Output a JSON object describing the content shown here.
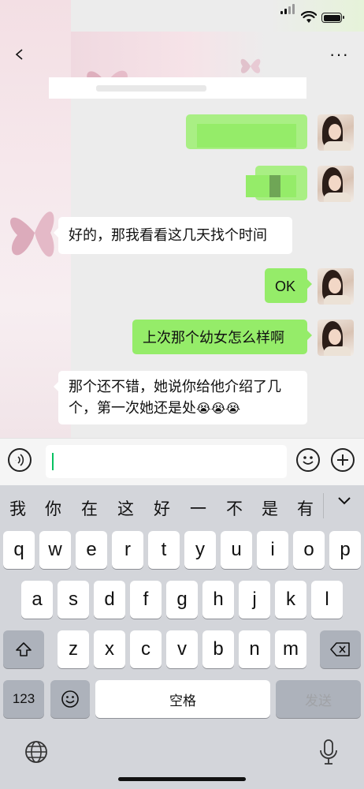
{
  "status_bar": {
    "signal": "signal-icon",
    "wifi": "wifi-icon",
    "battery": "battery-icon"
  },
  "nav": {
    "back_icon": "chevron-left-icon",
    "more_label": "···"
  },
  "messages": [
    {
      "side": "right",
      "text": ""
    },
    {
      "side": "right",
      "text": ""
    },
    {
      "side": "left",
      "text": "好的，那我看看这几天找个时间"
    },
    {
      "side": "right",
      "text": "OK"
    },
    {
      "side": "right",
      "text": "上次那个幼女怎么样啊"
    },
    {
      "side": "left",
      "text_line1": "那个还不错，她说你给他介绍了几",
      "text_line2": "个，第一次她还是处",
      "emoji": "😭😭😭"
    }
  ],
  "input_bar": {
    "voice_icon": "voice-icon",
    "emoji_icon": "emoji-icon",
    "plus_icon": "plus-icon",
    "value": ""
  },
  "keyboard": {
    "candidates": [
      "我",
      "你",
      "在",
      "这",
      "好",
      "一",
      "不",
      "是",
      "有"
    ],
    "row1": [
      "q",
      "w",
      "e",
      "r",
      "t",
      "y",
      "u",
      "i",
      "o",
      "p"
    ],
    "row2": [
      "a",
      "s",
      "d",
      "f",
      "g",
      "h",
      "j",
      "k",
      "l"
    ],
    "row3": [
      "z",
      "x",
      "c",
      "v",
      "b",
      "n",
      "m"
    ],
    "num_label": "123",
    "space_label": "空格",
    "send_label": "发送",
    "shift_icon": "shift-icon",
    "delete_icon": "delete-icon",
    "emoji_key_icon": "emoji-icon",
    "globe_icon": "globe-icon",
    "mic_icon": "microphone-icon"
  },
  "colors": {
    "bubble_right": "#95ec69",
    "bubble_left": "#ffffff",
    "accent": "#07c160"
  }
}
